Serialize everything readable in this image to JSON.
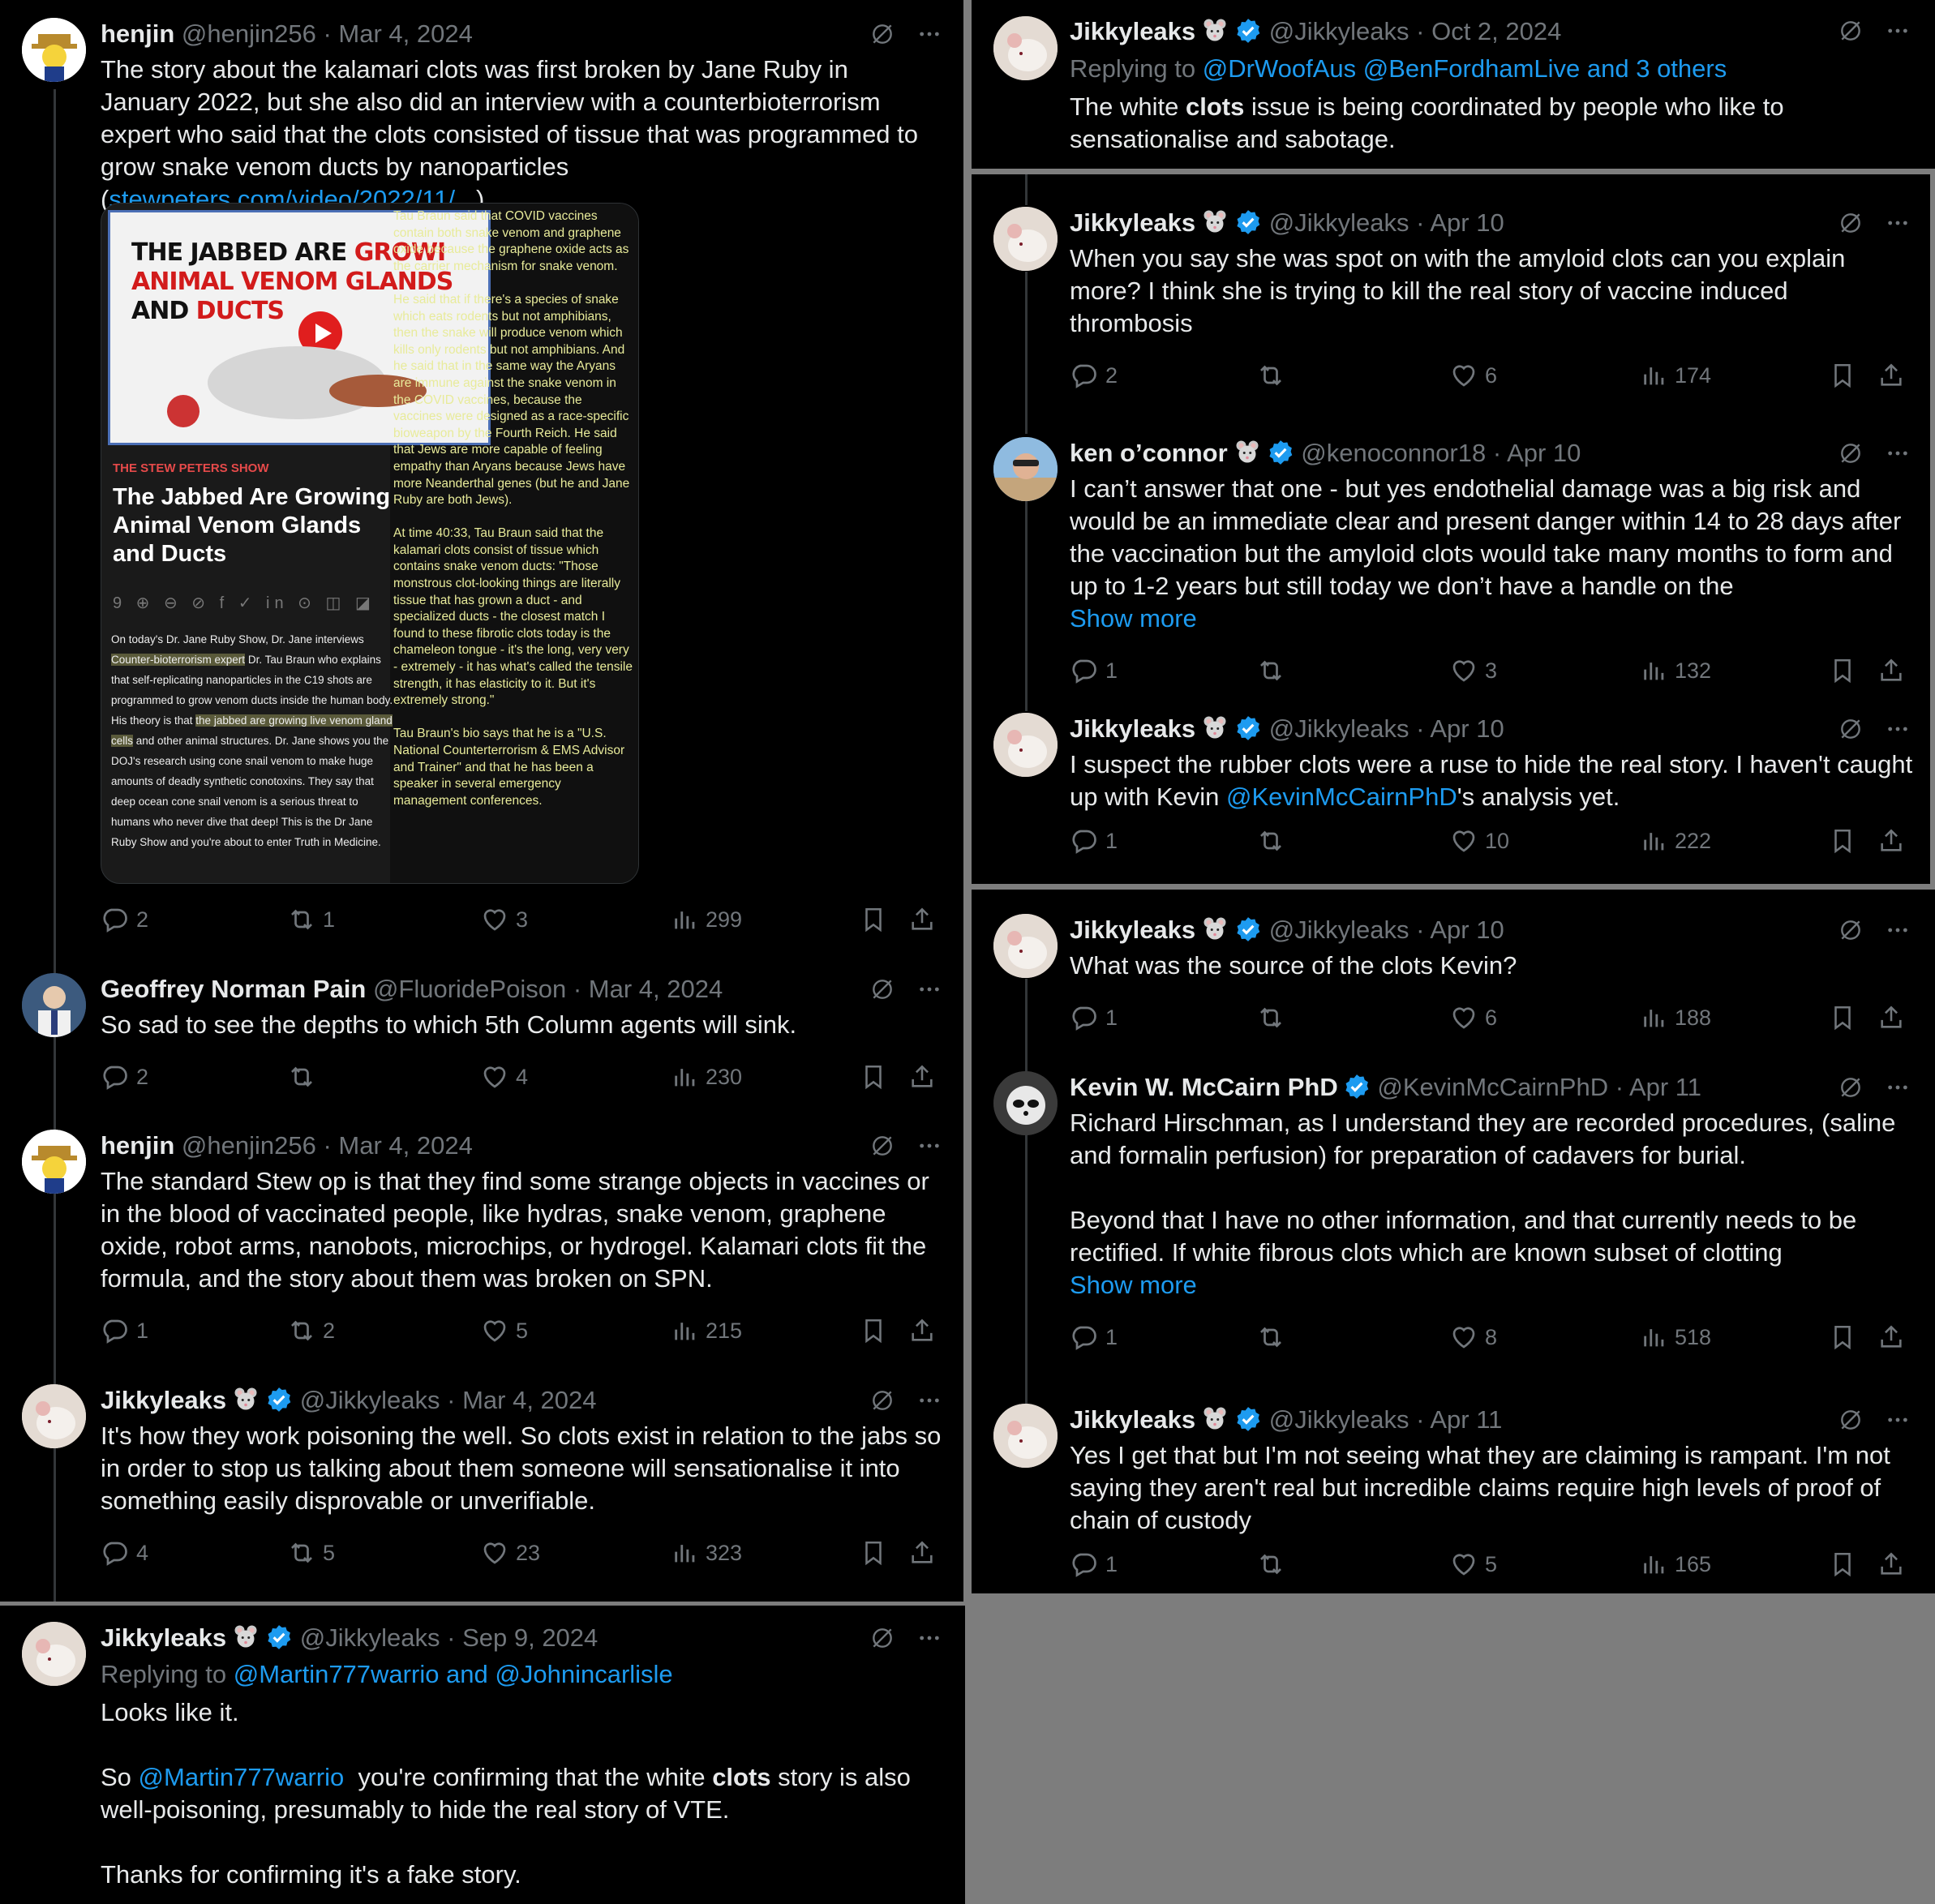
{
  "left_panel": {
    "tweets": [
      {
        "name": "henjin",
        "handle": "@henjin256",
        "date": "Mar 4, 2024",
        "text_before_link": "The story about the kalamari clots was first broken by Jane Ruby in January 2022, but she also did an interview with a counterbioterrorism expert who said that the clots consisted of tissue that was programmed to grow snake venom ducts by nanoparticles (",
        "link": "stewpeters.com/video/2022/11/...",
        "text_after_link": ").",
        "media": {
          "thumb_title_white_1": "THE JABBED ARE ",
          "thumb_title_red_1": "GROWI",
          "thumb_title_red_2": "ANIMAL VENOM GLANDS",
          "thumb_title_white_3": "AND ",
          "thumb_title_red_3": "DUCTS",
          "show_label": "THE STEW PETERS SHOW",
          "show_title": "The Jabbed Are Growing Animal Venom Glands and Ducts",
          "share_icons": "9 ⊕ ⊖ ⊘ f ✓ in ⊙ ◫ ◪",
          "desc_1": "On today's Dr. Jane Ruby Show, Dr. Jane interviews ",
          "desc_hl_1": "Counter-bioterrorism expert",
          "desc_2": " Dr. Tau Braun who explains that self-replicating nanoparticles in the C19 shots are programmed to grow venom ducts inside the human body. His theory is that ",
          "desc_hl_2": "the jabbed are growing live venom gland cells",
          "desc_3": " and other animal structures. Dr. Jane shows you the DOJ's research using cone snail venom to make huge amounts of deadly synthetic conotoxins. They say that deep ocean cone snail venom is a serious threat to humans who never dive that deep! This is the Dr Jane Ruby Show and you're about to enter Truth in Medicine.",
          "side_text": "Tau Braun said that COVID vaccines contain both snake venom and graphene oxide because the graphene oxide acts as the carrier mechanism for snake venom.\n\nHe said that if there's a species of snake which eats rodents but not amphibians, then the snake will produce venom which kills only rodents but not amphibians. And he said that in the same way the Aryans are immune against the snake venom in the COVID vaccines, because the vaccines were designed as a race-specific bioweapon by the Fourth Reich. He said that Jews are more capable of feeling empathy than Aryans because Jews have more Neanderthal genes (but he and Jane Ruby are both Jews).\n\nAt time 40:33, Tau Braun said that the kalamari clots consist of tissue which contains snake venom ducts: \"Those monstrous clot-looking things are literally tissue that has grown a duct - and specialized ducts - the closest match I found to these fibrotic clots today is the chameleon tongue - it's the long, very very - extremely - it has what's called the tensile strength, it has elasticity to it. But it's extremely strong.\"\n\nTau Braun's bio says that he is a \"U.S. National Counterterrorism & EMS Advisor and Trainer\" and that he has been a speaker in several emergency management conferences."
        },
        "replies": "2",
        "reposts": "1",
        "likes": "3",
        "views": "299"
      },
      {
        "name": "Geoffrey Norman Pain",
        "handle": "@FluoridePoison",
        "date": "Mar 4, 2024",
        "text": "So sad to see the depths to which 5th Column agents will sink.",
        "replies": "2",
        "reposts": "",
        "likes": "4",
        "views": "230"
      },
      {
        "name": "henjin",
        "handle": "@henjin256",
        "date": "Mar 4, 2024",
        "text": "The standard Stew op is that they find some strange objects in vaccines or in the blood of vaccinated people, like hydras, snake venom, graphene oxide, robot arms, nanobots, microchips, or hydrogel. Kalamari clots fit the formula, and the story about them was broken on SPN.",
        "replies": "1",
        "reposts": "2",
        "likes": "5",
        "views": "215"
      },
      {
        "name": "Jikkyleaks",
        "handle": "@Jikkyleaks",
        "date": "Mar 4, 2024",
        "text": "It's how they work poisoning the well. So clots exist in relation to the jabs so in order to stop us talking about them someone will sensationalise it into something easily disprovable or unverifiable.",
        "replies": "4",
        "reposts": "5",
        "likes": "23",
        "views": "323"
      }
    ]
  },
  "bottom_left_tweet": {
    "name": "Jikkyleaks",
    "handle": "@Jikkyleaks",
    "date": "Sep 9, 2024",
    "replying_label": "Replying to ",
    "replying_handles": "@Martin777warrio and @Johnincarlisle",
    "line1": "Looks like it.",
    "line2_prefix": "So ",
    "line2_mention": "@Martin777warrio",
    "line2_mid": "  you're confirming that the white ",
    "line2_bold": "clots",
    "line2_rest": " story is also well-poisoning, presumably to hide the real story of VTE.",
    "line3": "Thanks for confirming it's a fake story."
  },
  "top_right_tweet": {
    "name": "Jikkyleaks",
    "handle": "@Jikkyleaks",
    "date": "Oct 2, 2024",
    "replying_label": "Replying to ",
    "replying_handles": "@DrWoofAus @BenFordhamLive and 3 others",
    "text_prefix": "The white ",
    "text_bold": "clots",
    "text_rest": " issue is being coordinated by people who like to sensationalise and sabotage."
  },
  "mid_right_panel": {
    "tweets": [
      {
        "name": "Jikkyleaks",
        "handle": "@Jikkyleaks",
        "date": "Apr 10",
        "text": "When you say she was spot on with the amyloid clots can you explain more? I think she is trying to kill the real story of vaccine induced thrombosis",
        "replies": "2",
        "reposts": "",
        "likes": "6",
        "views": "174"
      },
      {
        "name": "ken o’connor",
        "handle": "@kenoconnor18",
        "date": "Apr 10",
        "text": "I can’t answer that one - but yes endothelial damage was a big risk and would be an immediate clear and present danger within 14 to 28 days after the vaccination but the amyloid clots would take many months to form and up to 1-2 years but still today we don’t have a handle on the",
        "show_more": "Show more",
        "replies": "1",
        "reposts": "",
        "likes": "3",
        "views": "132"
      },
      {
        "name": "Jikkyleaks",
        "handle": "@Jikkyleaks",
        "date": "Apr 10",
        "text_before": "I suspect the rubber clots were a ruse to hide the real story. I haven't caught up with Kevin ",
        "mention": "@KevinMcCairnPhD",
        "text_after": "'s analysis yet.",
        "replies": "1",
        "reposts": "",
        "likes": "10",
        "views": "222"
      }
    ]
  },
  "lower_right_panel": {
    "tweets": [
      {
        "name": "Jikkyleaks",
        "handle": "@Jikkyleaks",
        "date": "Apr 10",
        "text": "What was the source of the clots Kevin?",
        "replies": "1",
        "reposts": "",
        "likes": "6",
        "views": "188"
      },
      {
        "name": "Kevin W. McCairn PhD",
        "handle": "@KevinMcCairnPhD",
        "date": "Apr 11",
        "text": "Richard Hirschman, as I understand they are recorded procedures, (saline and formalin perfusion) for preparation of cadavers for burial.\n\nBeyond that I have no other information, and that currently needs to be rectified. If white fibrous clots which are known subset of clotting",
        "show_more": "Show more",
        "replies": "1",
        "reposts": "",
        "likes": "8",
        "views": "518"
      },
      {
        "name": "Jikkyleaks",
        "handle": "@Jikkyleaks",
        "date": "Apr 11",
        "text": "Yes I get that but I'm not seeing what they are claiming is rampant. I'm not saying they aren't real but incredible claims require high levels of proof of chain of custody",
        "replies": "1",
        "reposts": "",
        "likes": "5",
        "views": "165"
      }
    ]
  },
  "colors": {
    "background": "#000000",
    "link": "#1d9bf0",
    "muted": "#71767b",
    "verified": "#1d9bf0",
    "divider": "#7d7d7d"
  },
  "icons": [
    "reply-icon",
    "repost-icon",
    "like-icon",
    "views-icon",
    "bookmark-icon",
    "share-icon",
    "grok-icon",
    "more-icon",
    "verified-icon",
    "rat-emoji"
  ]
}
